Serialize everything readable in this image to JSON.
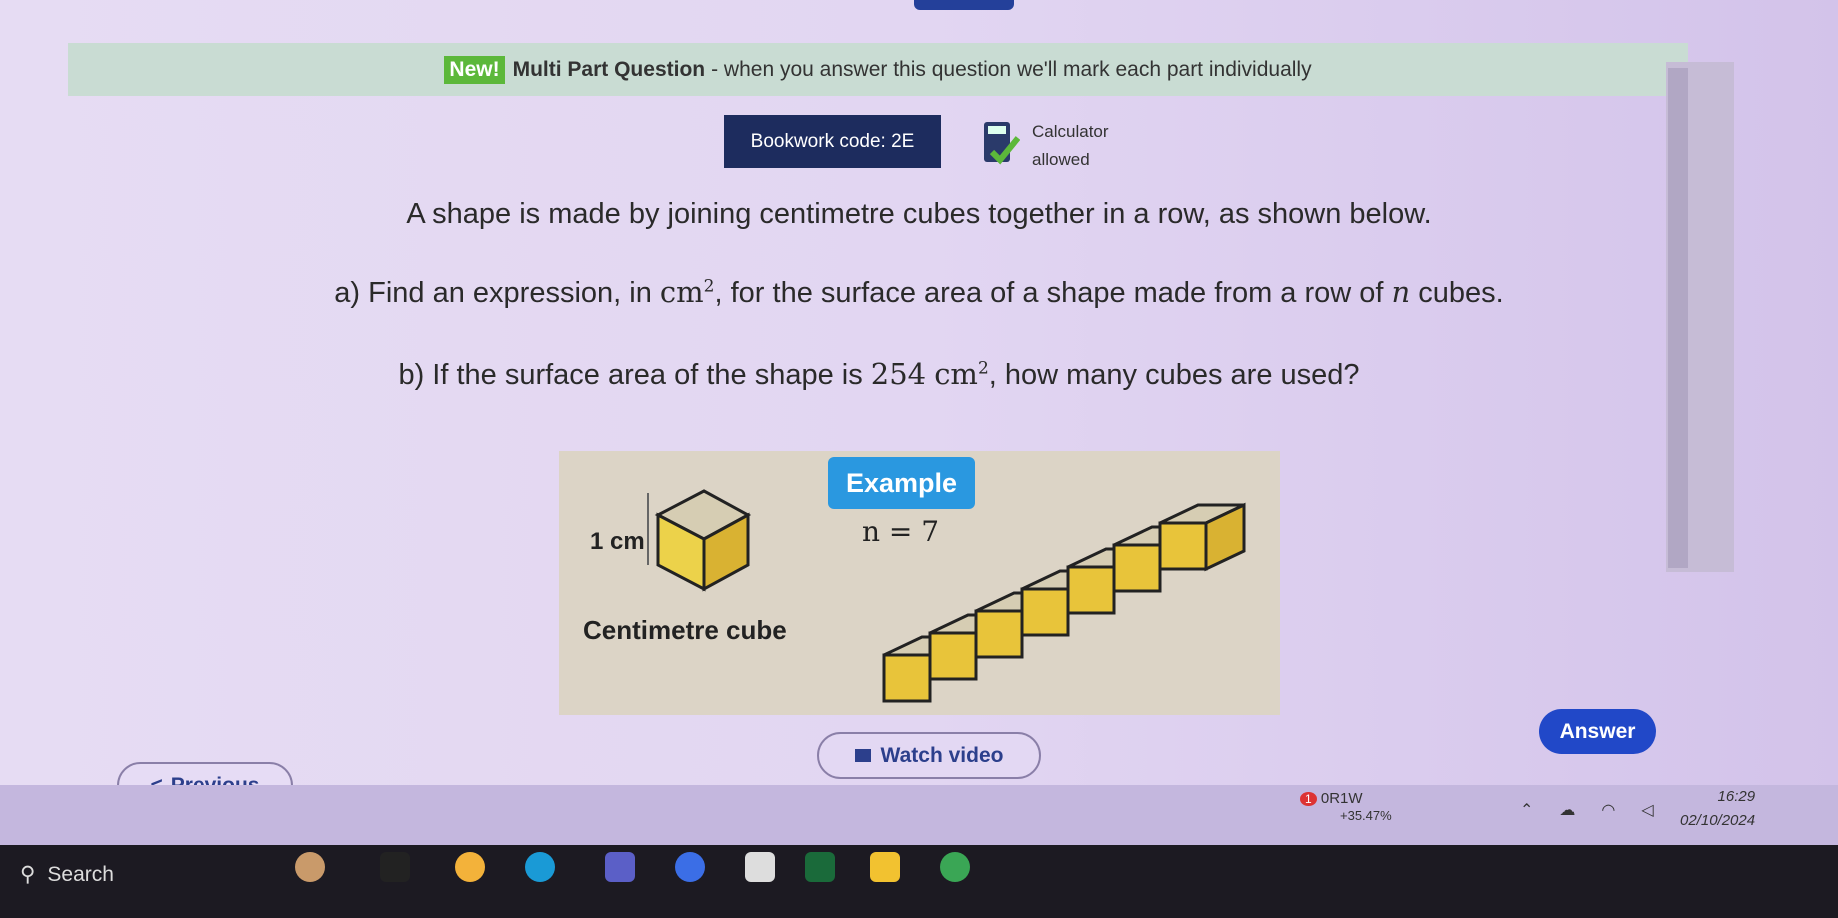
{
  "banner": {
    "new_badge": "New!",
    "title": "Multi Part Question",
    "text": "- when you answer this question we'll mark each part individually"
  },
  "bookwork": {
    "label": "Bookwork code: 2E"
  },
  "calculator": {
    "line1": "Calculator",
    "line2": "allowed",
    "icon": "calculator-check-icon"
  },
  "question": {
    "intro": "A shape is made by joining centimetre cubes together in a row, as shown below.",
    "a_prefix": "a) Find an expression, in ",
    "a_unit": "cm",
    "a_sup": "2",
    "a_mid": ", for the surface area of a shape made from a row of ",
    "a_var": "n",
    "a_suffix": " cubes.",
    "b_prefix": "b) If the surface area of the shape is ",
    "b_value": "254",
    "b_unit": "cm",
    "b_sup": "2",
    "b_suffix": ", how many cubes are used?"
  },
  "figure": {
    "cube_size_label": "1 cm",
    "cube_caption": "Centimetre cube",
    "example_label": "Example",
    "n_label": "n = 7",
    "cube_count": 7,
    "cube_color": "#e8c43a",
    "top_color": "#d6cdb3"
  },
  "buttons": {
    "previous": "Previous",
    "watch_video": "Watch video",
    "answer": "Answer"
  },
  "taskbar": {
    "search": "Search",
    "stock_name": "0R1W",
    "stock_change": "+35.47%",
    "notification_count": "1",
    "time": "16:29",
    "date": "02/10/2024"
  },
  "colors": {
    "accent": "#2148c8",
    "bookwork_bg": "#1d2c5e",
    "new_badge": "#5cb83a",
    "example_bg": "#2a98e0"
  }
}
